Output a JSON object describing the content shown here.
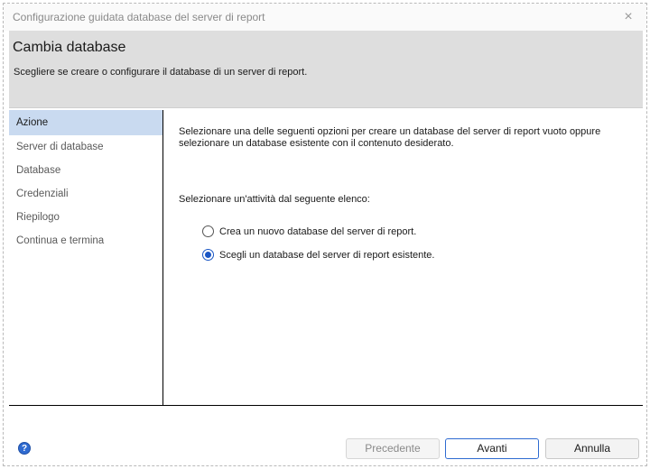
{
  "window": {
    "title": "Configurazione guidata database del server di report",
    "close_icon": "×"
  },
  "header": {
    "title": "Cambia database",
    "subtitle": "Scegliere se creare o configurare il database di un server di report."
  },
  "sidebar": {
    "items": [
      {
        "label": "Azione",
        "active": true
      },
      {
        "label": "Server di database",
        "active": false
      },
      {
        "label": "Database",
        "active": false
      },
      {
        "label": "Credenziali",
        "active": false
      },
      {
        "label": "Riepilogo",
        "active": false
      },
      {
        "label": "Continua e termina",
        "active": false
      }
    ]
  },
  "content": {
    "description": "Selezionare una delle seguenti opzioni per creare un database del server di report vuoto oppure selezionare un database esistente con il contenuto desiderato.",
    "prompt": "Selezionare un'attività dal seguente elenco:",
    "options": [
      {
        "label": "Crea un nuovo database del server di report.",
        "selected": false
      },
      {
        "label": "Scegli un database del server di report esistente.",
        "selected": true
      }
    ]
  },
  "footer": {
    "help_icon": "help-icon",
    "prev_label": "Precedente",
    "next_label": "Avanti",
    "cancel_label": "Annulla"
  },
  "colors": {
    "accent": "#2f6bd1",
    "header_bg": "#dedede",
    "nav_active_bg": "#c9daf0"
  }
}
